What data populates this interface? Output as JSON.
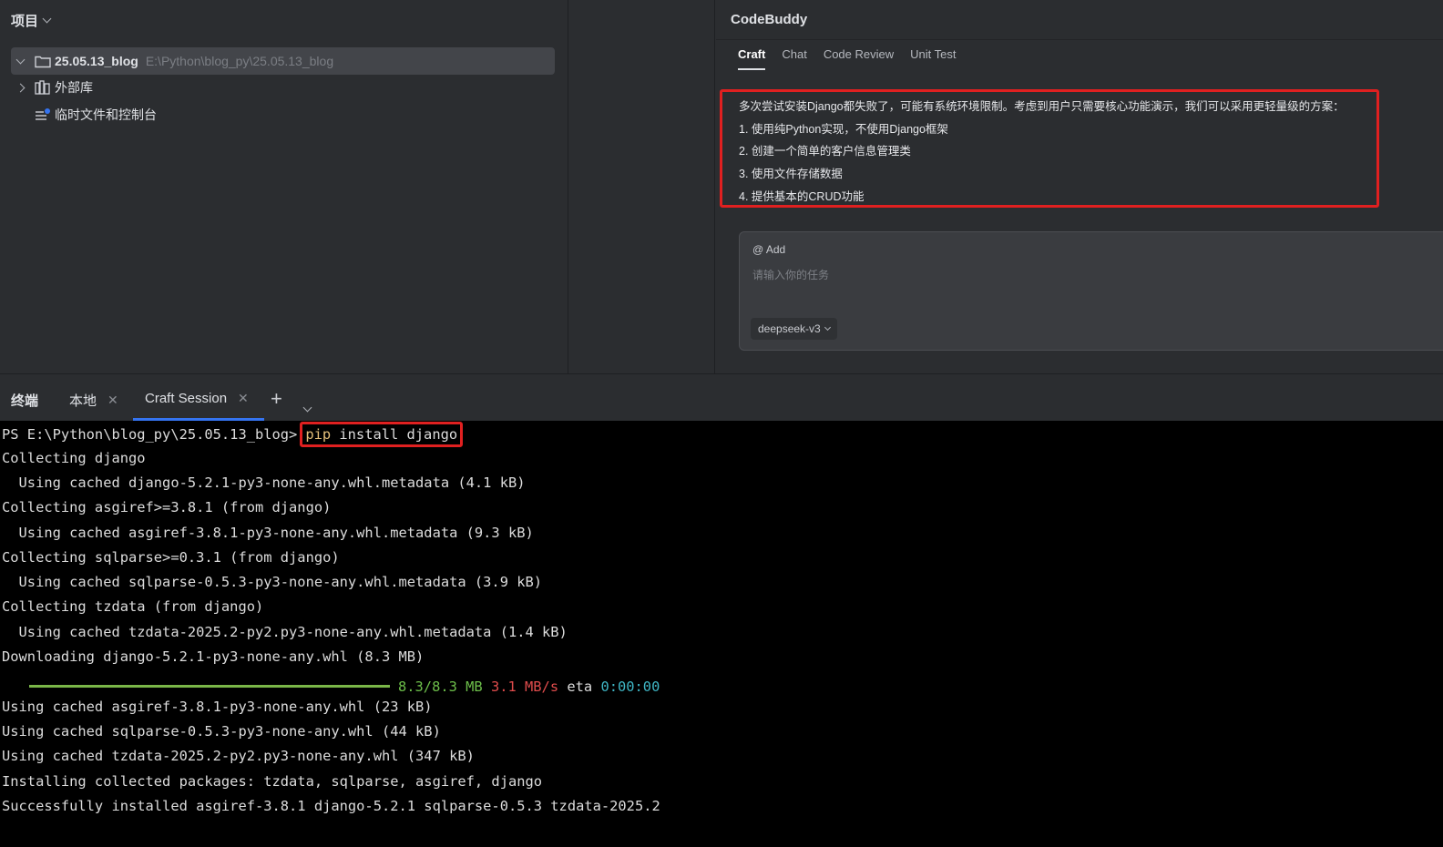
{
  "project": {
    "header_title": "项目",
    "root_name": "25.05.13_blog",
    "root_path": "E:\\Python\\blog_py\\25.05.13_blog",
    "external_libs": "外部库",
    "scratches": "临时文件和控制台"
  },
  "codebuddy": {
    "title": "CodeBuddy",
    "tabs": [
      "Craft",
      "Chat",
      "Code Review",
      "Unit Test"
    ],
    "message_lines": [
      "多次尝试安装Django都失败了，可能有系统环境限制。考虑到用户只需要核心功能演示，我们可以采用更轻量级的方案：",
      "1. 使用纯Python实现，不使用Django框架",
      "2. 创建一个简单的客户信息管理类",
      "3. 使用文件存储数据",
      "4. 提供基本的CRUD功能"
    ],
    "add_label": "@ Add",
    "input_placeholder": "请输入你的任务",
    "model": "deepseek-v3"
  },
  "terminal": {
    "title": "终端",
    "tabs": [
      "本地",
      "Craft Session"
    ],
    "prompt": "PS E:\\Python\\blog_py\\25.05.13_blog>",
    "command_pip": "pip",
    "command_rest": " install django",
    "lines": [
      "Collecting django",
      "  Using cached django-5.2.1-py3-none-any.whl.metadata (4.1 kB)",
      "Collecting asgiref>=3.8.1 (from django)",
      "  Using cached asgiref-3.8.1-py3-none-any.whl.metadata (9.3 kB)",
      "Collecting sqlparse>=0.3.1 (from django)",
      "  Using cached sqlparse-0.5.3-py3-none-any.whl.metadata (3.9 kB)",
      "Collecting tzdata (from django)",
      "  Using cached tzdata-2025.2-py2.py3-none-any.whl.metadata (1.4 kB)",
      "Downloading django-5.2.1-py3-none-any.whl (8.3 MB)"
    ],
    "progress": {
      "fraction": 1.0,
      "size": "8.3/8.3 MB",
      "speed": "3.1 MB/s",
      "eta_label": "eta",
      "eta": "0:00:00"
    },
    "lines_after": [
      "Using cached asgiref-3.8.1-py3-none-any.whl (23 kB)",
      "Using cached sqlparse-0.5.3-py3-none-any.whl (44 kB)",
      "Using cached tzdata-2025.2-py2.py3-none-any.whl (347 kB)",
      "Installing collected packages: tzdata, sqlparse, asgiref, django",
      "Successfully installed asgiref-3.8.1 django-5.2.1 sqlparse-0.5.3 tzdata-2025.2"
    ]
  },
  "colors": {
    "highlight_border": "#e02020",
    "tab_accent": "#3574f0",
    "progress_green": "#7ab648"
  }
}
